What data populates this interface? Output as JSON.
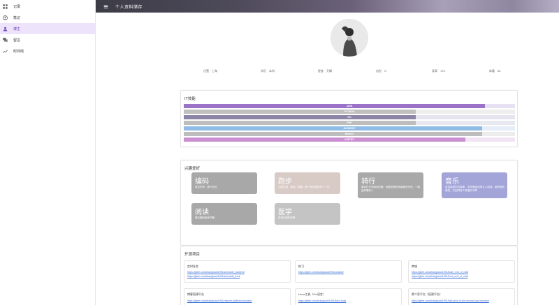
{
  "sidebar": {
    "items": [
      {
        "label": "记录",
        "icon": "grid-icon",
        "active": false
      },
      {
        "label": "笔记",
        "icon": "account-circle-icon",
        "active": false
      },
      {
        "label": "博主",
        "icon": "person-icon",
        "active": true
      },
      {
        "label": "留言",
        "icon": "chat-icon",
        "active": false
      },
      {
        "label": "时间线",
        "icon": "trending-icon",
        "active": false
      }
    ]
  },
  "header": {
    "title": "个人资料储存",
    "menu_icon": "menu-icon"
  },
  "profile": {
    "info": [
      {
        "key": "位置",
        "value": "上海"
      },
      {
        "key": "学历",
        "value": "本科"
      },
      {
        "key": "星座",
        "value": "天蝎"
      },
      {
        "key": "血型",
        "value": "O"
      },
      {
        "key": "身高",
        "value": "175"
      },
      {
        "key": "体重",
        "value": "65"
      }
    ]
  },
  "skills": {
    "title": "IT技能",
    "items": [
      {
        "name": "JAVA",
        "level": 0.91,
        "color": "#9a72c8",
        "track": "#e8e0f3"
      },
      {
        "name": "PYTHON",
        "level": 0.7,
        "color": "#bfbfbf",
        "track": "#eeeeee"
      },
      {
        "name": "GO",
        "level": 0.7,
        "color": "#8c85a8",
        "track": "#e6e4ee"
      },
      {
        "name": "PHP",
        "level": 0.7,
        "color": "#bdbdbd",
        "track": "#e8e8f0"
      },
      {
        "name": "ELEMENT",
        "level": 0.9,
        "color": "#8fbce6",
        "track": "#e5eef8"
      },
      {
        "name": "NodeJs",
        "level": 0.9,
        "color": "#bdbdbd",
        "track": "#ededed"
      },
      {
        "name": "VUETIFY",
        "level": 0.85,
        "color": "#c98fd1",
        "track": "#f1e4f3"
      }
    ]
  },
  "hobbies": {
    "title": "兴趣爱好",
    "items": [
      {
        "name": "编码",
        "desc": "改变世界，那只文的",
        "color": "#a8a8a8"
      },
      {
        "name": "跑步",
        "desc": "公园大道，操场，绿道，跑一段的感觉来了一年",
        "color": "#d8cbc6"
      },
      {
        "name": "骑行",
        "desc": "喜欢在不同景色的路，而是说是的风景和快乐的，一路追风看的人",
        "color": "#a9a9a9"
      },
      {
        "name": "音乐",
        "desc": "欢迎摇滚乐的旋律， 好的歌曲总是让人回味，越听越有感觉，它如同每个灵魂的子弹",
        "color": "#a3a5d8"
      },
      {
        "name": "阅读",
        "desc": "喜欢翻阅各种书籍",
        "color": "#a8a8a8"
      },
      {
        "name": "医学",
        "desc": "探索未知的世界",
        "color": "#c4c4c4"
      }
    ]
  },
  "projects": {
    "title": "开源项目",
    "items": [
      {
        "name": "定时任务",
        "links": [
          "https://gitee.com/zhangkuan1991/schedule_backend",
          "https://gitee.com/zhangkuan1991/schedule_front"
        ]
      },
      {
        "name": "练习",
        "links": [
          "https://gitee.com/zhangkuan1991/practice"
        ]
      },
      {
        "name": "商城",
        "links": [
          "https://gitee.com/zhangkuan1991/back_end_of_mall",
          "https://gitee.com/zhangkuan1991/front_end_of_mall"
        ]
      },
      {
        "name": "博客搭建平台",
        "links": [
          "https://gitee.com/zhangkuan1991/resume-platform-backend"
        ]
      },
      {
        "name": "Linux工具（Go语言）",
        "links": [
          "https://gitee.com/zhangkuan1991/linux-tools"
        ]
      },
      {
        "name": "第二家平台（搭建平台）",
        "links": [
          "https://gitee.com/zhangkuan1991/half-price-of-the-second-cup-backend"
        ]
      }
    ]
  }
}
